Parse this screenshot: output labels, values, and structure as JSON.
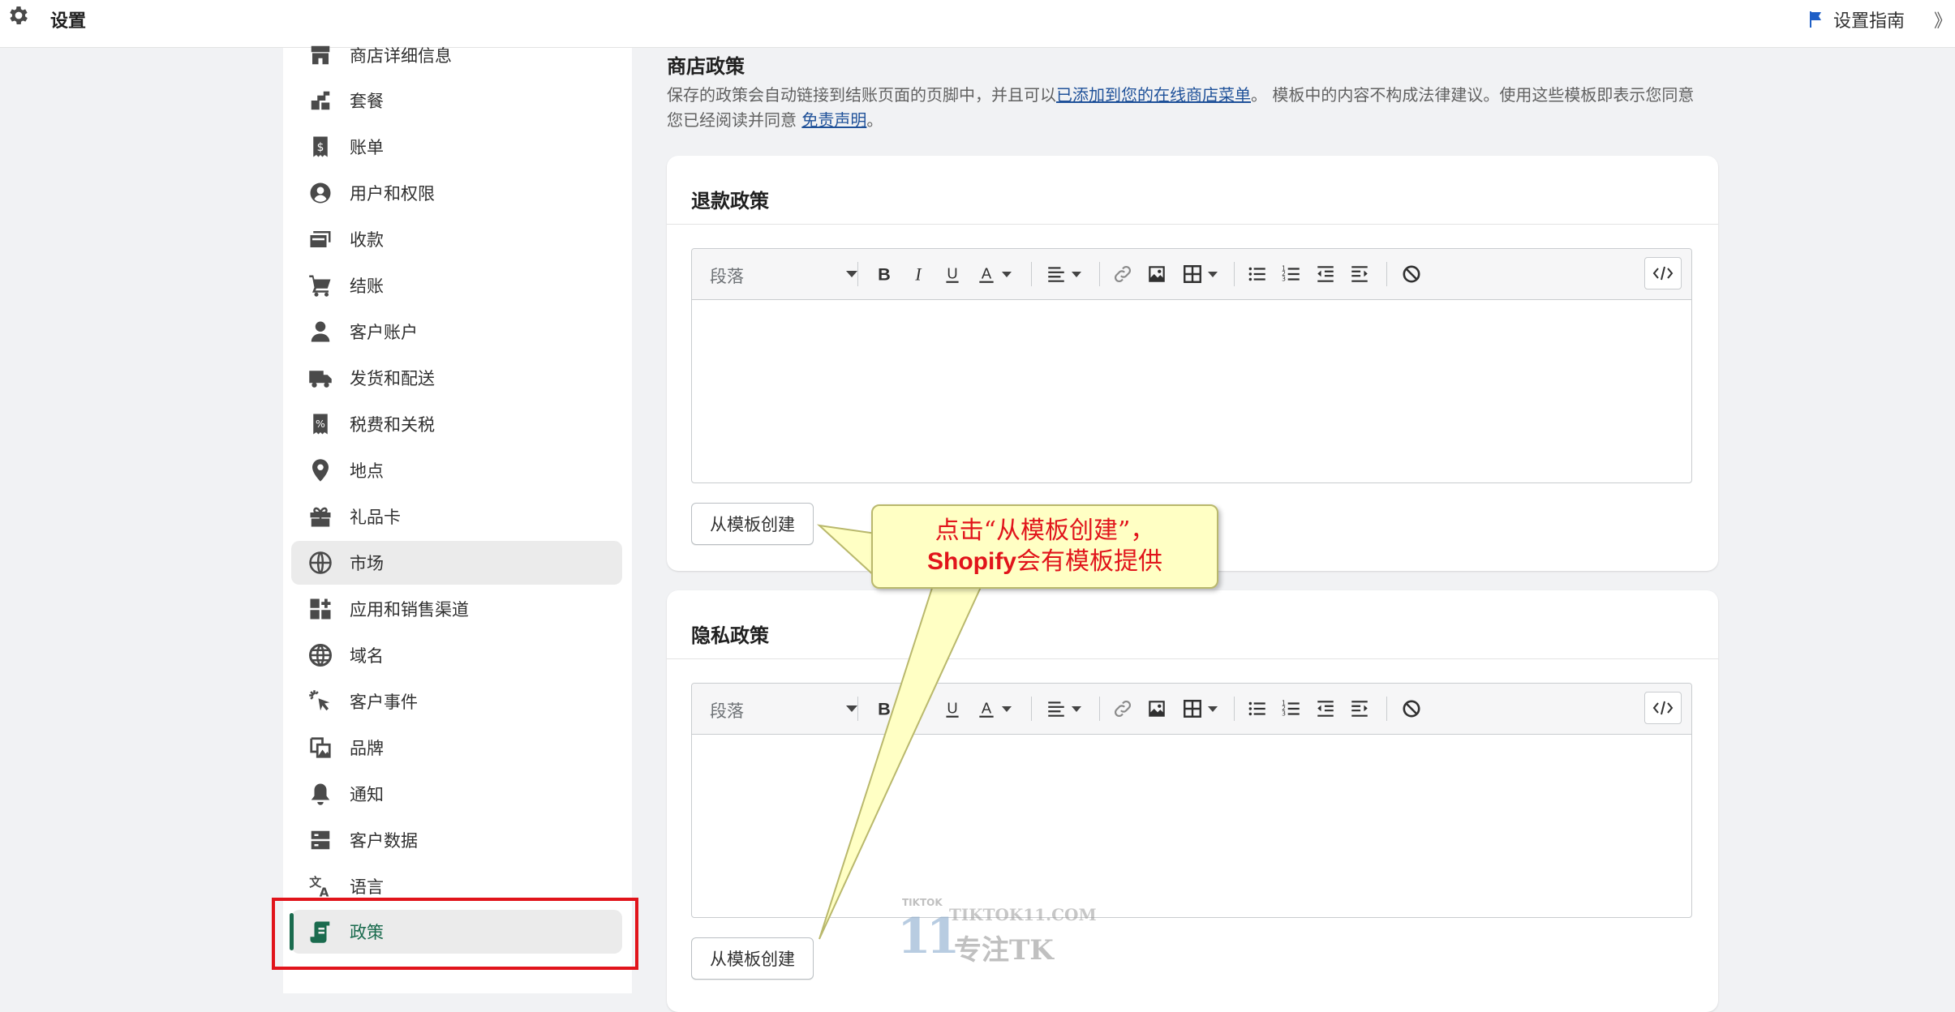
{
  "topbar": {
    "title": "设置",
    "guide_label": "设置指南",
    "edge_glyph": "》"
  },
  "sidebar": {
    "items": [
      {
        "label": "商店详细信息",
        "icon": "store-icon"
      },
      {
        "label": "套餐",
        "icon": "plan-icon"
      },
      {
        "label": "账单",
        "icon": "billing-icon"
      },
      {
        "label": "用户和权限",
        "icon": "user-circle-icon"
      },
      {
        "label": "收款",
        "icon": "payments-icon"
      },
      {
        "label": "结账",
        "icon": "cart-icon"
      },
      {
        "label": "客户账户",
        "icon": "person-icon"
      },
      {
        "label": "发货和配送",
        "icon": "truck-icon"
      },
      {
        "label": "税费和关税",
        "icon": "tax-icon"
      },
      {
        "label": "地点",
        "icon": "location-pin-icon"
      },
      {
        "label": "礼品卡",
        "icon": "gift-icon"
      },
      {
        "label": "市场",
        "icon": "globe-icon"
      },
      {
        "label": "应用和销售渠道",
        "icon": "apps-icon"
      },
      {
        "label": "域名",
        "icon": "domain-globe-icon"
      },
      {
        "label": "客户事件",
        "icon": "cursor-click-icon"
      },
      {
        "label": "品牌",
        "icon": "brand-image-icon"
      },
      {
        "label": "通知",
        "icon": "bell-icon"
      },
      {
        "label": "客户数据",
        "icon": "data-icon"
      },
      {
        "label": "语言",
        "icon": "translate-icon"
      },
      {
        "label": "政策",
        "icon": "policy-scroll-icon"
      }
    ],
    "active": "政策",
    "hovered": "市场"
  },
  "main": {
    "section_title": "商店政策",
    "desc_part1": "保存的政策会自动链接到结账页面的页脚中，并且可以",
    "desc_link1": "已添加到您的在线商店菜单",
    "desc_part2": "。 模板中的内容不构成法律建议。使用这些模板即表示您同意您已经阅读并同意 ",
    "desc_link2": "免责声明",
    "desc_part3": "。",
    "cards": [
      {
        "title": "退款政策",
        "format_select": "段落",
        "template_button": "从模板创建"
      },
      {
        "title": "隐私政策",
        "format_select": "段落",
        "template_button": "从模板创建"
      }
    ]
  },
  "callout": {
    "line1": "点击“从模板创建”，",
    "line2_bold": "Shopify",
    "line2_rest": "会有模板提供"
  },
  "watermark": {
    "small": "TIKTOK",
    "site": "TIKTOK11.COM",
    "tagline": "专注TK",
    "logo": "11"
  },
  "colors": {
    "accent_green": "#1a6b4e",
    "highlight_red": "#e1141b",
    "callout_bg": "#ffffc4",
    "link_blue": "#1f5199"
  }
}
